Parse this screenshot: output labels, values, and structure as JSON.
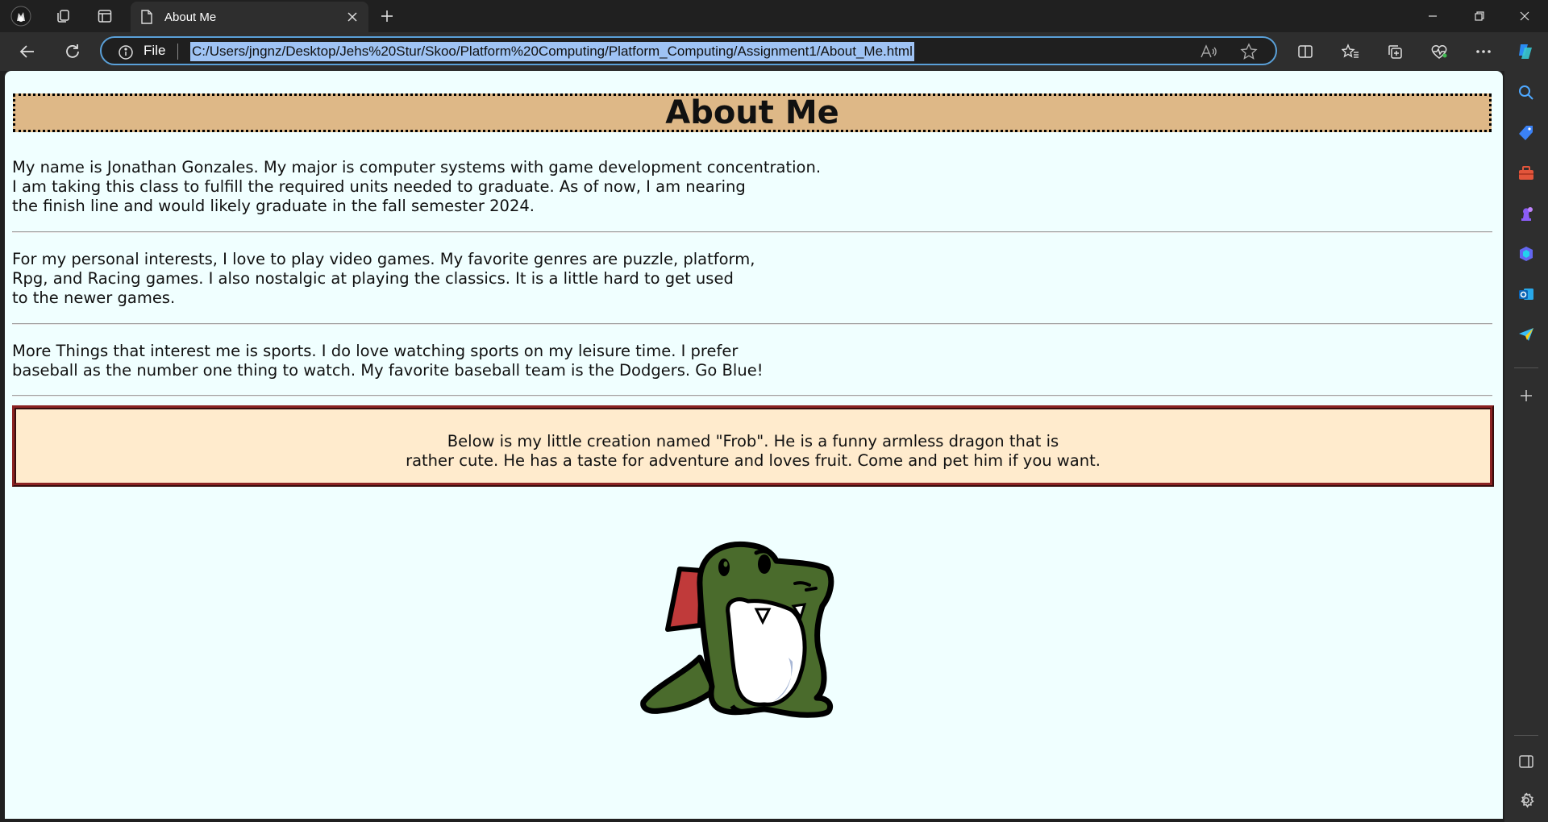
{
  "browser": {
    "tab_title": "About Me",
    "address_scheme_label": "File",
    "url": "C:/Users/jngnz/Desktop/Jehs%20Stur/Skoo/Platform%20Computing/Platform_Computing/Assignment1/About_Me.html",
    "accent_color": "#5aa0d8"
  },
  "page": {
    "heading": "About Me",
    "paragraphs": [
      "My name is Jonathan Gonzales. My major is computer systems with game development concentration.\nI am taking this class to fulfill the required units needed to graduate. As of now, I am nearing\nthe finish line and would likely graduate in the fall semester 2024.",
      "For my personal interests, I love to play video games. My favorite genres are puzzle, platform,\nRpg, and Racing games. I also nostalgic at playing the classics. It is a little hard to get used\nto the newer games.",
      "More Things that interest me is sports. I do love watching sports on my leisure time. I prefer\nbaseball as the number one thing to watch. My favorite baseball team is the Dodgers. Go Blue!"
    ],
    "frob_lines": [
      "Below is my little creation named \"Frob\". He is a funny armless dragon that is",
      "rather cute. He has a taste for adventure and loves fruit. Come and pet him if you want."
    ],
    "colors": {
      "page_background": "#f0ffff",
      "heading_background": "#deb887",
      "box_background": "#ffebcd",
      "box_border": "#8b2323",
      "frob_green": "#4a6b2c"
    }
  }
}
